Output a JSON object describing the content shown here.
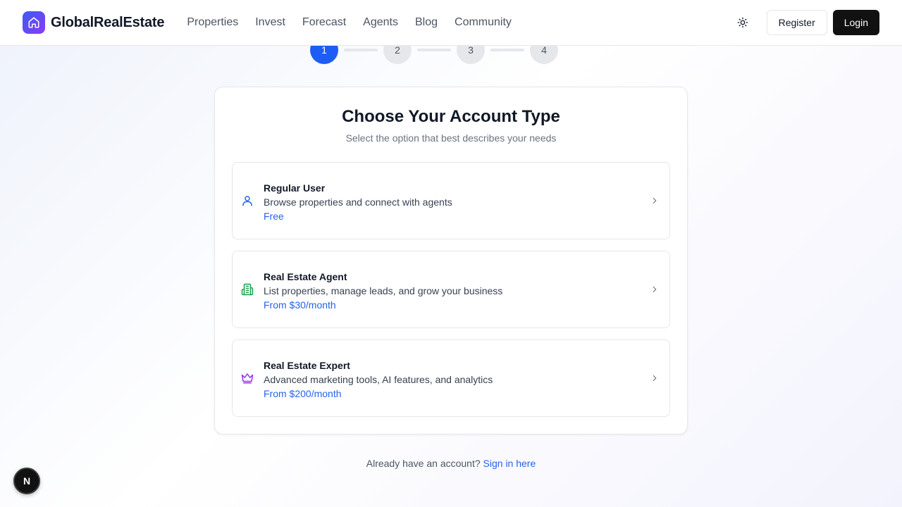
{
  "header": {
    "brand": "GlobalRealEstate",
    "nav": [
      "Properties",
      "Invest",
      "Forecast",
      "Agents",
      "Blog",
      "Community"
    ],
    "theme_icon": "sun-icon",
    "register_label": "Register",
    "login_label": "Login"
  },
  "steps": {
    "items": [
      "1",
      "2",
      "3",
      "4"
    ],
    "current": 1,
    "colors": {
      "active": "#1d5cf5",
      "inactive": "#e5e7eb"
    }
  },
  "card": {
    "title": "Choose Your Account Type",
    "subtitle": "Select the option that best describes your needs",
    "options": [
      {
        "icon": "user-icon",
        "icon_color": "#2563eb",
        "title": "Regular User",
        "description": "Browse properties and connect with agents",
        "price": "Free"
      },
      {
        "icon": "building-icon",
        "icon_color": "#16a34a",
        "title": "Real Estate Agent",
        "description": "List properties, manage leads, and grow your business",
        "price": "From $30/month"
      },
      {
        "icon": "crown-icon",
        "icon_color": "#9333ea",
        "title": "Real Estate Expert",
        "description": "Advanced marketing tools, AI features, and analytics",
        "price": "From $200/month"
      }
    ]
  },
  "footer": {
    "prompt": "Already have an account?",
    "link": "Sign in here"
  },
  "dev_badge": "N",
  "colors": {
    "accent": "#2563eb",
    "login_bg": "#111111"
  }
}
